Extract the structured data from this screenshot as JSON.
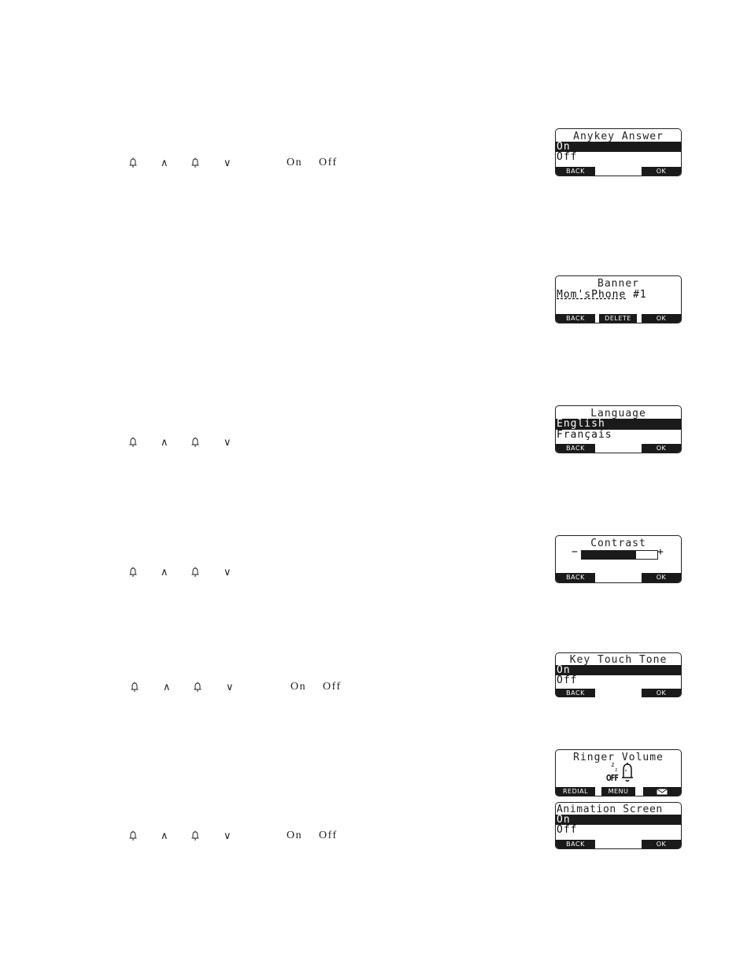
{
  "key_rows": [
    {
      "id": "anykey",
      "keys": [
        "bell-icon",
        "^",
        "bell-icon",
        "v"
      ],
      "options": [
        "On",
        "Off"
      ]
    },
    {
      "id": "language",
      "keys": [
        "bell-icon",
        "^",
        "bell-icon",
        "v"
      ],
      "options": []
    },
    {
      "id": "contrast",
      "keys": [
        "bell-icon",
        "^",
        "bell-icon",
        "v"
      ],
      "options": []
    },
    {
      "id": "keytouch",
      "keys": [
        "bell-icon",
        "^",
        "bell-icon",
        "v"
      ],
      "options": [
        "On",
        "Off"
      ]
    },
    {
      "id": "animation",
      "keys": [
        "bell-icon",
        "^",
        "bell-icon",
        "v"
      ],
      "options": [
        "On",
        "Off"
      ]
    }
  ],
  "screens": {
    "anykey": {
      "title": "Anykey Answer",
      "rows": [
        "On",
        "Off"
      ],
      "selected": 0,
      "softkeys": {
        "left": "BACK",
        "right": "OK"
      }
    },
    "banner": {
      "title": "Banner",
      "text_underlined": "Mom'sPhone",
      "text_rest": " #1",
      "softkeys": {
        "left": "BACK",
        "mid": "DELETE",
        "right": "OK"
      }
    },
    "language": {
      "title": "Language",
      "rows": [
        "English",
        "Français"
      ],
      "selected": 0,
      "softkeys": {
        "left": "BACK",
        "right": "OK"
      }
    },
    "contrast": {
      "title": "Contrast",
      "minus": "−",
      "plus": "+",
      "level_fraction": 0.72,
      "softkeys": {
        "left": "BACK",
        "right": "OK"
      }
    },
    "keytouch": {
      "title": "Key Touch Tone",
      "rows": [
        "On",
        "Off"
      ],
      "selected": 0,
      "softkeys": {
        "left": "BACK",
        "right": "OK"
      }
    },
    "ringer": {
      "title": "Ringer Volume",
      "art_label": "OFF",
      "art_icon": "sleeping-bell-icon",
      "softkeys": {
        "left": "REDIAL",
        "mid": "MENU",
        "right_icon": "envelope-icon"
      }
    },
    "animation": {
      "title": "Animation Screen",
      "rows": [
        "On",
        "Off"
      ],
      "selected": 0,
      "softkeys": {
        "left": "BACK",
        "right": "OK"
      }
    }
  },
  "glyphs": {
    "up": "∧",
    "down": "∨"
  }
}
